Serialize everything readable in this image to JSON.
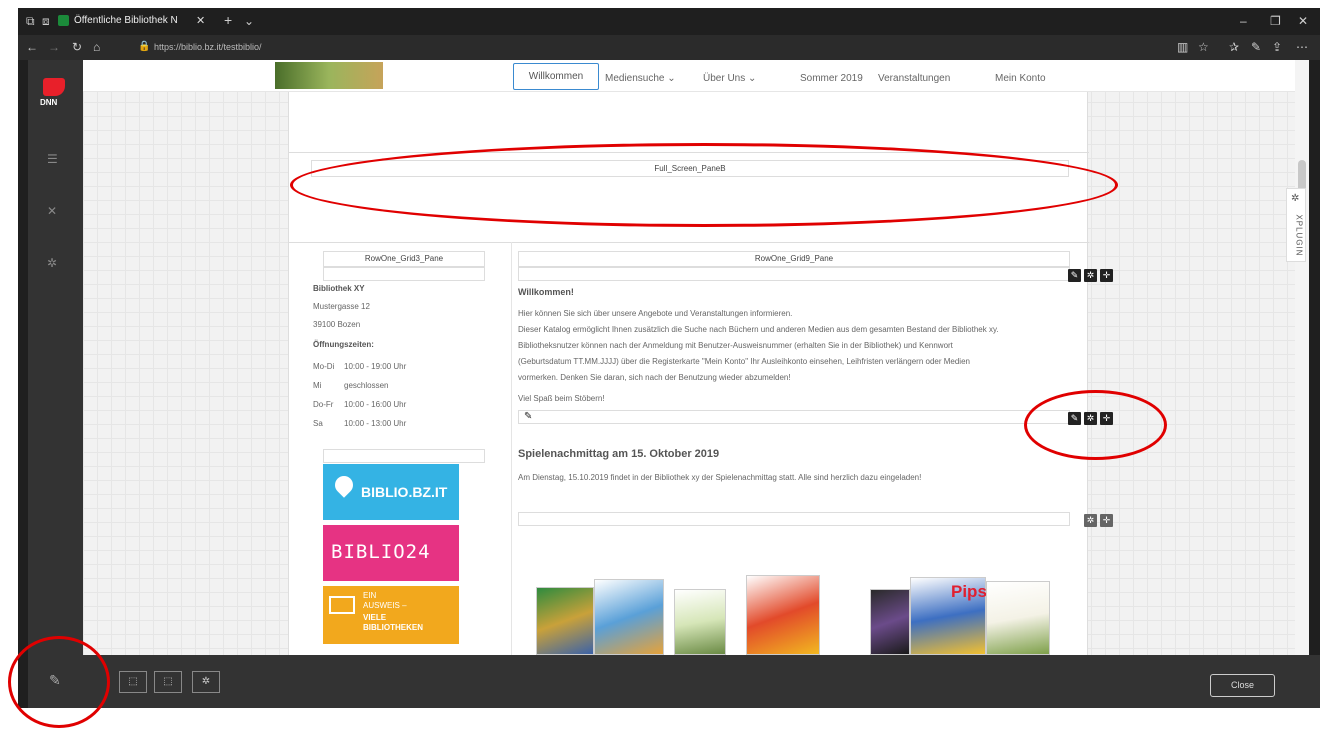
{
  "browser": {
    "tab_title": "Öffentliche Bibliothek N",
    "url": "https://biblio.bz.it/testbiblio/"
  },
  "dnn": {
    "logo_text": "DNN"
  },
  "nav": {
    "items": [
      "Willkommen",
      "Mediensuche",
      "Über Uns",
      "Sommer 2019",
      "Veranstaltungen",
      "Mein Konto"
    ]
  },
  "panes": {
    "full_screen": "Full_Screen_PaneB",
    "left": "RowOne_Grid3_Pane",
    "right": "RowOne_Grid9_Pane"
  },
  "side_plugin": "XPLUGIN",
  "library": {
    "name": "Bibliothek XY",
    "street": "Mustergasse 12",
    "city": "39100 Bozen",
    "hours_title": "Öffnungszeiten:",
    "hours": [
      {
        "day": "Mo-Di",
        "time": "10:00 - 19:00 Uhr"
      },
      {
        "day": "Mi",
        "time": "geschlossen"
      },
      {
        "day": "Do-Fr",
        "time": "10:00 - 16:00 Uhr"
      },
      {
        "day": "Sa",
        "time": "10:00 - 13:00 Uhr"
      }
    ]
  },
  "banners": {
    "biblio": "BIBLIO.BZ.IT",
    "biblio24": "BIBLIO24",
    "ausweis_1": "EIN",
    "ausweis_2": "AUSWEIS –",
    "ausweis_3": "VIELE",
    "ausweis_4": "BIBLIOTHEKEN"
  },
  "welcome": {
    "title": "Willkommen!",
    "line1": "Hier können Sie sich über unsere Angebote und Veranstaltungen informieren.",
    "line2": "Dieser Katalog ermöglicht Ihnen zusätzlich die Suche nach Büchern und anderen Medien aus dem gesamten Bestand der Bibliothek xy.",
    "line3": "Bibliotheksnutzer können nach der Anmeldung mit Benutzer-Ausweisnummer (erhalten Sie in der Bibliothek) und Kennwort",
    "line4": "(Geburtsdatum TT.MM.JJJJ) über die Registerkarte \"Mein Konto\" Ihr Ausleihkonto einsehen, Leihfristen verlängern oder Medien",
    "line5": "vormerken. Denken Sie daran, sich nach der Benutzung wieder abzumelden!",
    "line6": "Viel Spaß beim Stöbern!"
  },
  "event": {
    "title": "Spielenachmittag am 15. Oktober 2019",
    "text": "Am Dienstag, 15.10.2019 findet in der Bibliothek xy der Spielenachmittag statt. Alle sind herzlich dazu eingeladen!"
  },
  "books": {
    "pips": "Pips"
  },
  "bottom": {
    "close_label": "Close"
  }
}
